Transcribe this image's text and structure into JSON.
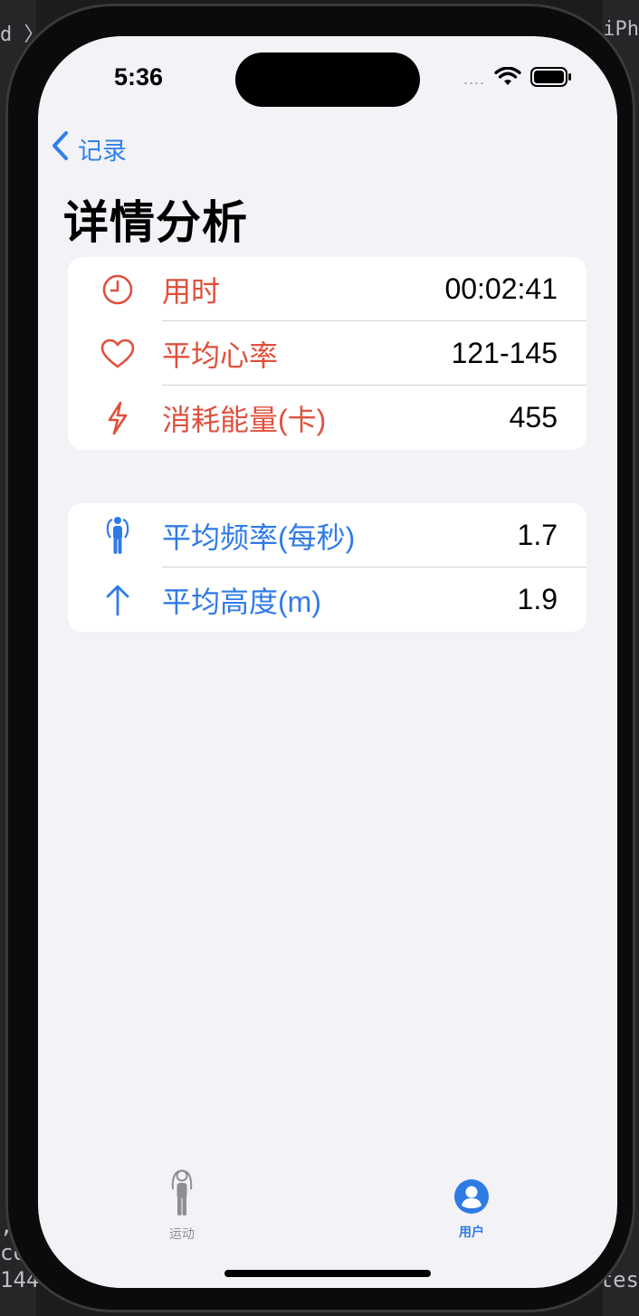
{
  "status_bar": {
    "time": "5:36",
    "signal_dots": "....",
    "icons": [
      "wifi-icon",
      "battery-icon"
    ]
  },
  "nav": {
    "back_label": "记录",
    "back_icon": "chevron-left-icon"
  },
  "page": {
    "title": "详情分析"
  },
  "colors": {
    "red": "#e0503d",
    "blue": "#2f7be6",
    "background": "#f2f2f7",
    "card": "#ffffff"
  },
  "section1": {
    "rows": [
      {
        "icon": "clock-icon",
        "label": "用时",
        "value": "00:02:41"
      },
      {
        "icon": "heart-icon",
        "label": "平均心率",
        "value": "121-145"
      },
      {
        "icon": "bolt-icon",
        "label": "消耗能量(卡)",
        "value": "455"
      }
    ]
  },
  "section2": {
    "rows": [
      {
        "icon": "jump-rope-icon",
        "label": "平均频率(每秒)",
        "value": "1.7"
      },
      {
        "icon": "arrow-up-icon",
        "label": "平均高度(m)",
        "value": "1.9"
      }
    ]
  },
  "tabbar": {
    "tabs": [
      {
        "icon": "person-standing-icon",
        "label": "运动",
        "selected": false
      },
      {
        "icon": "person-circle-icon",
        "label": "用户",
        "selected": true
      }
    ]
  },
  "background_text": {
    "left_top": "d 〉",
    "right_top": "e iPh",
    "left_1": ",",
    "left_2": "co",
    "left_3": "144",
    "right_bottom": "ites"
  }
}
